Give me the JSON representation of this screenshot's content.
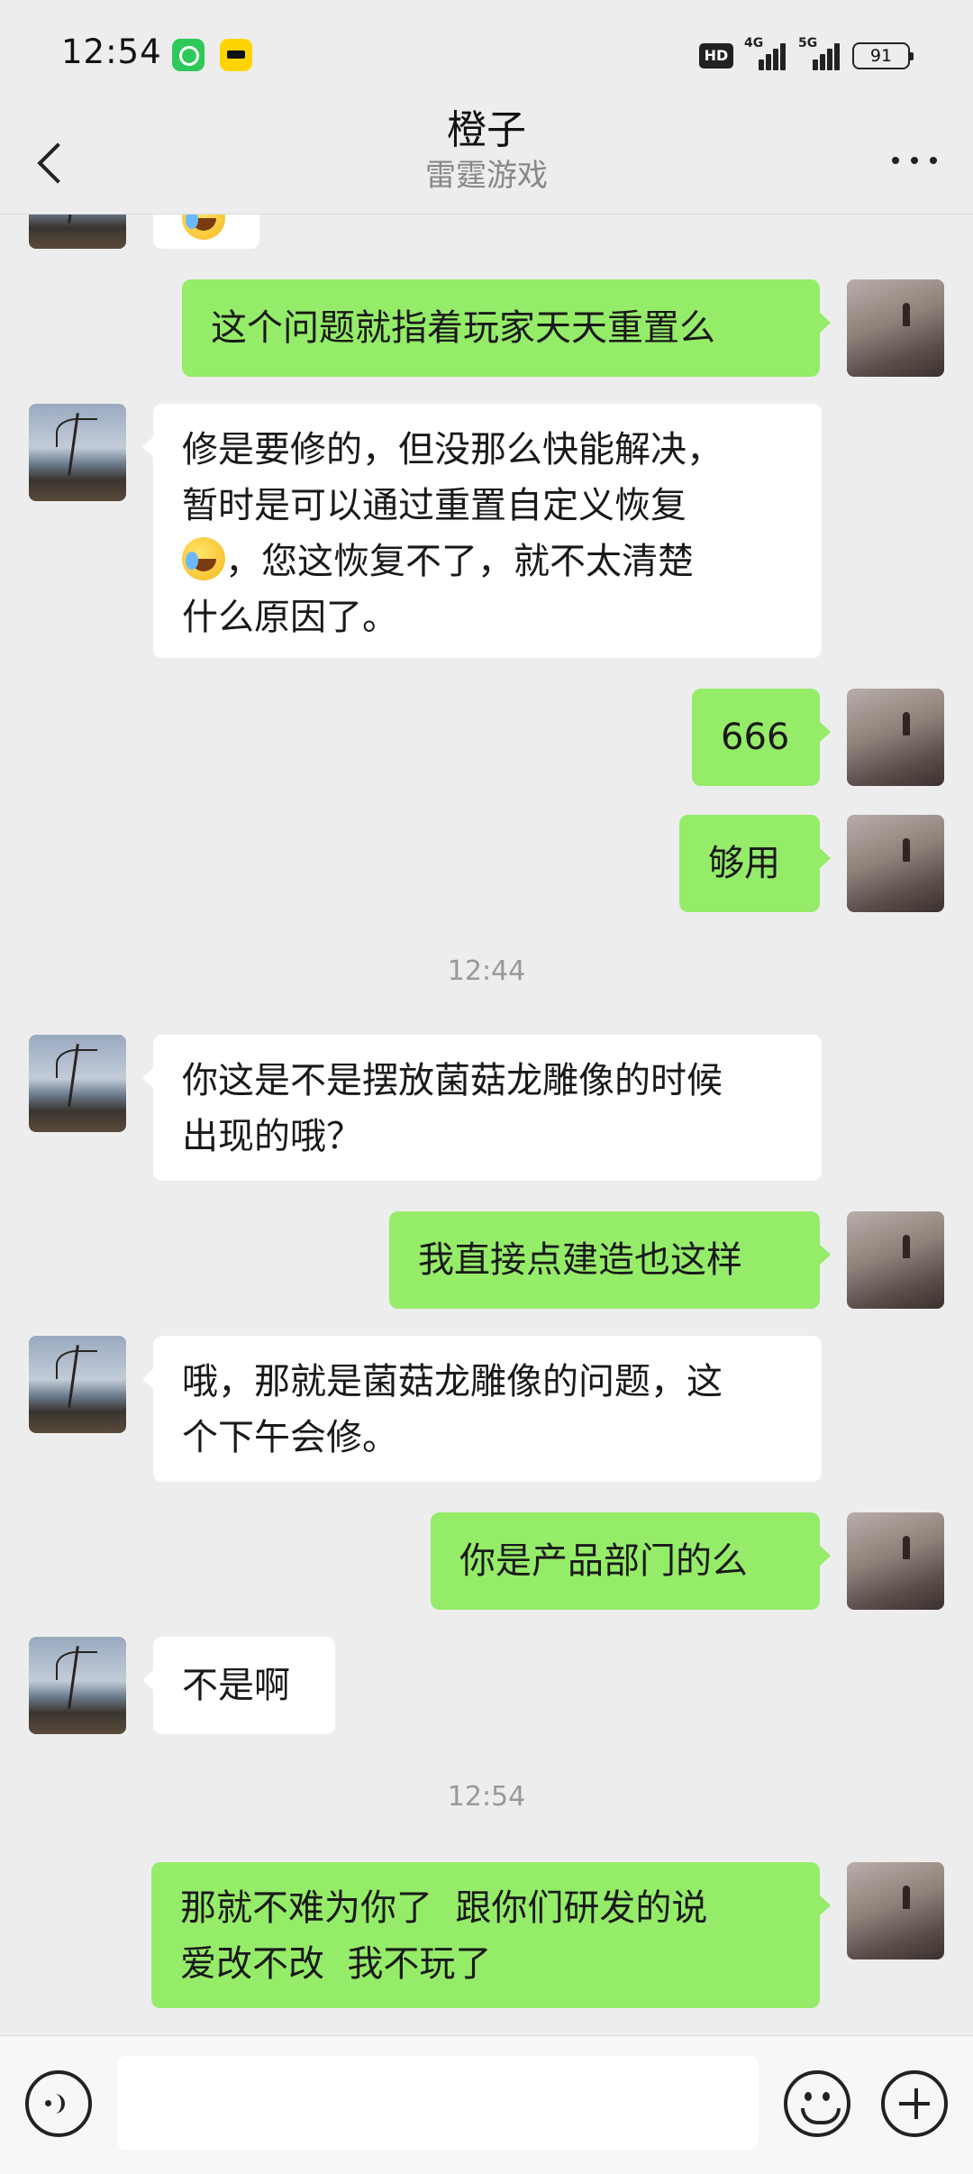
{
  "status_bar": {
    "time": "12:54",
    "hd_label": "HD",
    "net_1": "4G",
    "net_2": "5G",
    "battery": "91"
  },
  "header": {
    "name": "橙子",
    "subtitle": "雷霆游戏"
  },
  "messages": [
    {
      "side": "in",
      "text": ""
    },
    {
      "side": "out",
      "text": "这个问题就指着玩家天天重置么"
    },
    {
      "side": "in",
      "line1": "修是要修的，但没那么快能解决，",
      "line2": "暂时是可以通过重置自定义恢复",
      "line3": "，您这恢复不了，就不太清楚",
      "line4": "什么原因了。",
      "emoji": "sob-laugh-emoji"
    },
    {
      "side": "out",
      "text": "666"
    },
    {
      "side": "out",
      "text": "够用"
    },
    {
      "side": "in",
      "line1": "你这是不是摆放菌菇龙雕像的时候",
      "line2": "出现的哦？"
    },
    {
      "side": "out",
      "text": "我直接点建造也这样"
    },
    {
      "side": "in",
      "line1": "哦，那就是菌菇龙雕像的问题，这",
      "line2": "个下午会修。"
    },
    {
      "side": "out",
      "text": "你是产品部门的么"
    },
    {
      "side": "in",
      "text": "不是啊"
    },
    {
      "side": "out",
      "line1": "那就不难为你了  跟你们研发的说",
      "line2": "爱改不改  我不玩了"
    }
  ],
  "timestamps": [
    "12:44",
    "12:54"
  ],
  "input": {
    "value": "",
    "placeholder": ""
  }
}
